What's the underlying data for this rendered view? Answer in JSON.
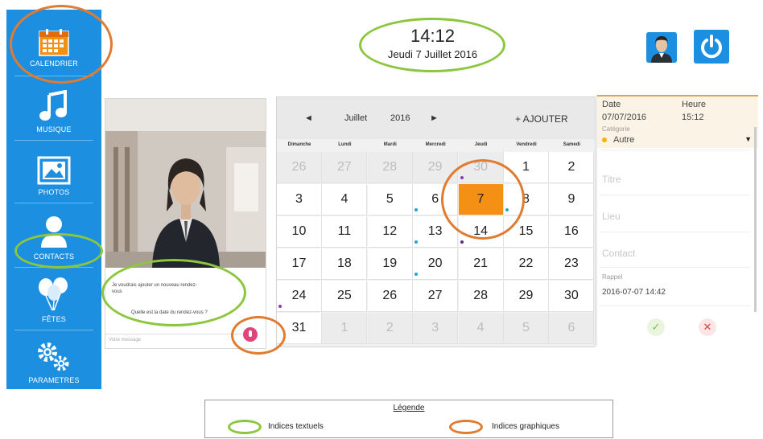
{
  "sidebar": {
    "items": [
      {
        "label": "CALENDRIER",
        "icon": "calendar-icon"
      },
      {
        "label": "MUSIQUE",
        "icon": "music-note-icon"
      },
      {
        "label": "PHOTOS",
        "icon": "picture-icon"
      },
      {
        "label": "CONTACTS",
        "icon": "person-icon"
      },
      {
        "label": "FÊTES",
        "icon": "balloons-icon"
      },
      {
        "label": "PARAMETRES",
        "icon": "gears-icon"
      }
    ]
  },
  "header": {
    "time": "14:12",
    "date": "Jeudi 7 Juillet 2016",
    "avatar_icon": "user-avatar-icon",
    "power_icon": "power-icon"
  },
  "chat": {
    "messages": [
      "Je voudrais ajouter un nouveau rendez-vous",
      "Quelle est la date du rendez-vous ?"
    ],
    "input_placeholder": "Votre message"
  },
  "calendar": {
    "prev": "◄",
    "month": "Juillet",
    "year": "2016",
    "next": "►",
    "add": "+ AJOUTER",
    "day_names": [
      "Dimanche",
      "Lundi",
      "Mardi",
      "Mercredi",
      "Jeudi",
      "Vendredi",
      "Samedi"
    ],
    "weeks": [
      [
        "26",
        "27",
        "28",
        "29",
        "30",
        "1",
        "2"
      ],
      [
        "3",
        "4",
        "5",
        "6",
        "7",
        "8",
        "9"
      ],
      [
        "10",
        "11",
        "12",
        "13",
        "14",
        "15",
        "16"
      ],
      [
        "17",
        "18",
        "19",
        "20",
        "21",
        "22",
        "23"
      ],
      [
        "24",
        "25",
        "26",
        "27",
        "28",
        "29",
        "30"
      ],
      [
        "31",
        "1",
        "2",
        "3",
        "4",
        "5",
        "6"
      ]
    ],
    "today": "7"
  },
  "form": {
    "date_label": "Date",
    "date_value": "07/07/2016",
    "hour_label": "Heure",
    "hour_value": "15:12",
    "category_label": "Catégorie",
    "category_value": "Autre",
    "title_placeholder": "Titre",
    "place_placeholder": "Lieu",
    "contact_placeholder": "Contact",
    "reminder_label": "Rappel",
    "reminder_value": "2016-07-07 14:42",
    "confirm": "✓",
    "cancel": "✕"
  },
  "legend": {
    "title": "Légende",
    "textual": "Indices textuels",
    "graphic": "Indices graphiques"
  },
  "colors": {
    "sidebar": "#1d8fe0",
    "today": "#f49014",
    "textual_ring": "#8cc63f",
    "graphic_ring": "#e07b30"
  }
}
